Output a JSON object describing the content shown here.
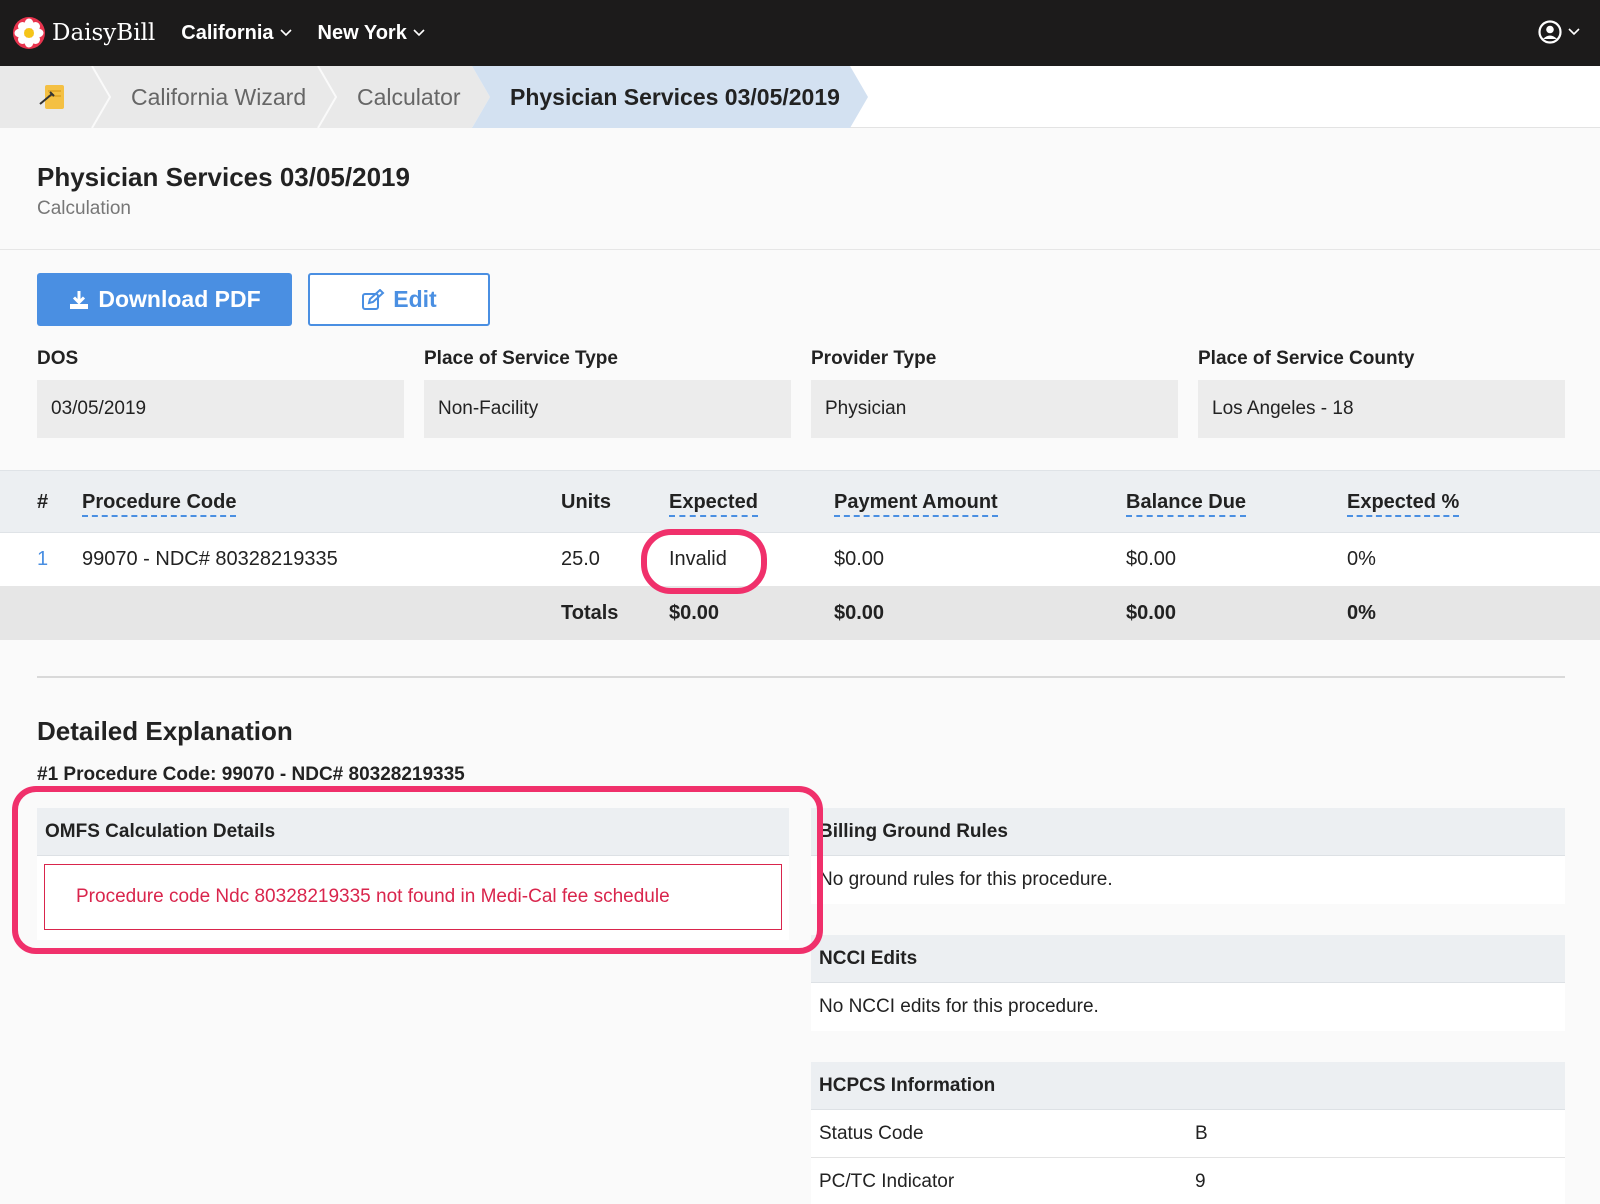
{
  "brand": {
    "name": "DaisyBill"
  },
  "nav": {
    "items": [
      "California",
      "New York"
    ]
  },
  "breadcrumb": {
    "items": [
      "California Wizard",
      "Calculator",
      "Physician Services 03/05/2019"
    ]
  },
  "header": {
    "title": "Physician Services 03/05/2019",
    "subtitle": "Calculation"
  },
  "actions": {
    "download": "Download PDF",
    "edit": "Edit"
  },
  "fields": [
    {
      "label": "DOS",
      "value": "03/05/2019"
    },
    {
      "label": "Place of Service Type",
      "value": "Non-Facility"
    },
    {
      "label": "Provider Type",
      "value": "Physician"
    },
    {
      "label": "Place of Service County",
      "value": "Los Angeles - 18"
    }
  ],
  "table": {
    "columns": [
      "#",
      "Procedure Code",
      "Units",
      "Expected",
      "Payment Amount",
      "Balance Due",
      "Expected %"
    ],
    "rows": [
      {
        "num": "1",
        "code": "99070 - NDC# 80328219335",
        "units": "25.0",
        "expected": "Invalid",
        "payment": "$0.00",
        "balance": "$0.00",
        "expected_pct": "0%"
      }
    ],
    "totals": {
      "label": "Totals",
      "expected": "$0.00",
      "payment": "$0.00",
      "balance": "$0.00",
      "expected_pct": "0%"
    }
  },
  "explanation": {
    "title": "Detailed Explanation",
    "procedure": "#1 Procedure Code: 99070 - NDC# 80328219335",
    "omfs": {
      "title": "OMFS Calculation Details",
      "error": "Procedure code Ndc 80328219335 not found in Medi-Cal fee schedule"
    },
    "ground_rules": {
      "title": "Billing Ground Rules",
      "text": "No ground rules for this procedure."
    },
    "ncci": {
      "title": "NCCI Edits",
      "text": "No NCCI edits for this procedure."
    },
    "hcpcs": {
      "title": "HCPCS Information",
      "rows": [
        {
          "key": "Status Code",
          "value": "B"
        },
        {
          "key": "PC/TC Indicator",
          "value": "9"
        }
      ]
    }
  },
  "colors": {
    "accent": "#4a8fe2",
    "error": "#d9254c",
    "highlight": "#f0306b",
    "topbar": "#1c1b1b"
  }
}
